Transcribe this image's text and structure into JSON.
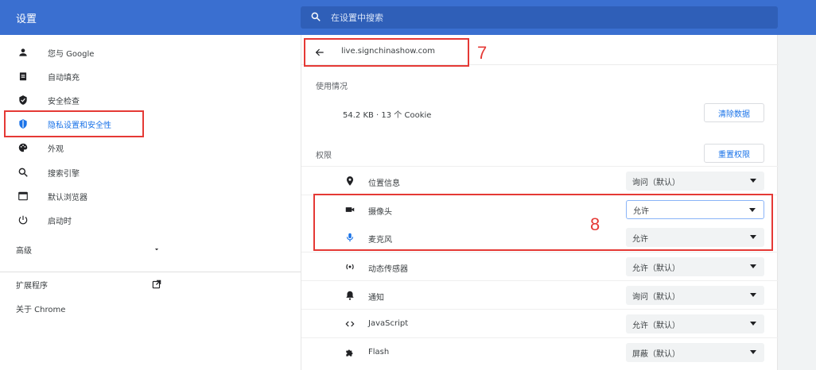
{
  "header": {
    "title": "设置",
    "search_placeholder": "在设置中搜索"
  },
  "sidebar": {
    "items": [
      {
        "label": "您与 Google",
        "icon": "person-icon"
      },
      {
        "label": "自动填充",
        "icon": "clipboard-icon"
      },
      {
        "label": "安全检查",
        "icon": "shield-check-icon"
      },
      {
        "label": "隐私设置和安全性",
        "icon": "shield-icon"
      },
      {
        "label": "外观",
        "icon": "palette-icon"
      },
      {
        "label": "搜索引擎",
        "icon": "search-icon"
      },
      {
        "label": "默认浏览器",
        "icon": "browser-icon"
      },
      {
        "label": "启动时",
        "icon": "power-icon"
      }
    ],
    "advanced": {
      "label": "高级",
      "icon": "chevron-down-icon"
    },
    "extensions": {
      "label": "扩展程序",
      "icon": "external-link-icon"
    },
    "about": {
      "label": "关于 Chrome"
    }
  },
  "site": {
    "url": "live.signchinashow.com",
    "back_icon": "arrow-left-icon"
  },
  "usage": {
    "heading": "使用情况",
    "text": "54.2 KB · 13 个 Cookie",
    "clear_label": "清除数据"
  },
  "permissions": {
    "heading": "权限",
    "reset_label": "重置权限",
    "rows": [
      {
        "label": "位置信息",
        "icon": "location-icon",
        "value": "询问（默认）"
      },
      {
        "label": "摄像头",
        "icon": "camera-icon",
        "value": "允许"
      },
      {
        "label": "麦克风",
        "icon": "mic-icon",
        "value": "允许"
      },
      {
        "label": "动态传感器",
        "icon": "sensor-icon",
        "value": "允许（默认）"
      },
      {
        "label": "通知",
        "icon": "bell-icon",
        "value": "询问（默认）"
      },
      {
        "label": "JavaScript",
        "icon": "code-icon",
        "value": "允许（默认）"
      },
      {
        "label": "Flash",
        "icon": "puzzle-icon",
        "value": "屏蔽（默认）"
      }
    ]
  },
  "annotations": {
    "step7": "7",
    "step8": "8"
  },
  "colors": {
    "header": "#3a6fd0",
    "highlight": "#e53935",
    "accent": "#1a73e8"
  }
}
